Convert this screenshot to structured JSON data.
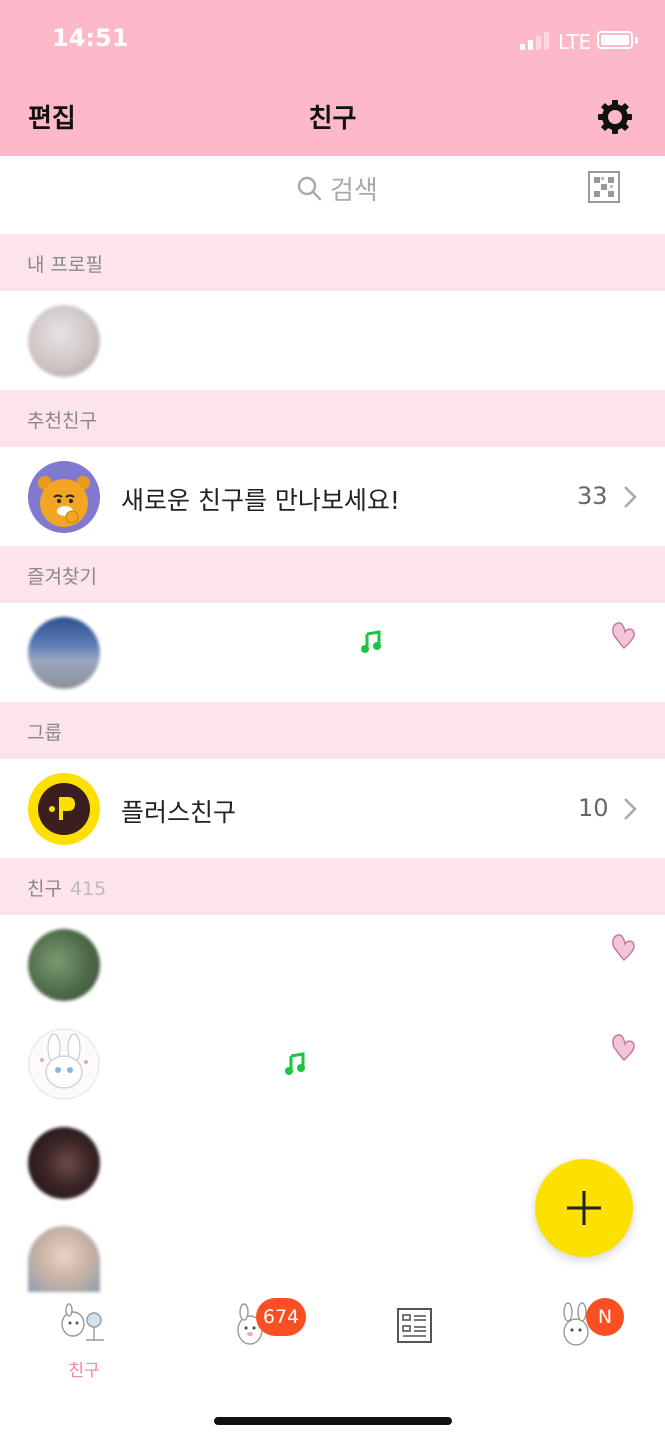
{
  "status_bar": {
    "time": "14:51",
    "network": "LTE"
  },
  "header": {
    "edit_label": "편집",
    "title": "친구",
    "settings_icon": "gear-icon"
  },
  "search": {
    "placeholder": "검색",
    "icon": "search-icon",
    "qr_icon": "qr-icon"
  },
  "sections": {
    "my_profile": {
      "label": "내 프로필"
    },
    "recommended": {
      "label": "추천친구",
      "row_text": "새로운 친구를 만나보세요!",
      "count": "33"
    },
    "favorites": {
      "label": "즐겨찾기"
    },
    "groups": {
      "label": "그룹",
      "row_text": "플러스친구",
      "count": "10"
    },
    "friends": {
      "label": "친구",
      "count": "415"
    }
  },
  "tab_bar": {
    "friends_label": "친구",
    "chats_badge": "674",
    "more_badge": "N"
  },
  "colors": {
    "header_bg": "#fdb8c9",
    "section_bg": "#fde4ea",
    "fab_yellow": "#fce000",
    "badge_orange": "#fa4f23",
    "music_green": "#1ec443",
    "active_tab_pink": "#f5839f"
  }
}
